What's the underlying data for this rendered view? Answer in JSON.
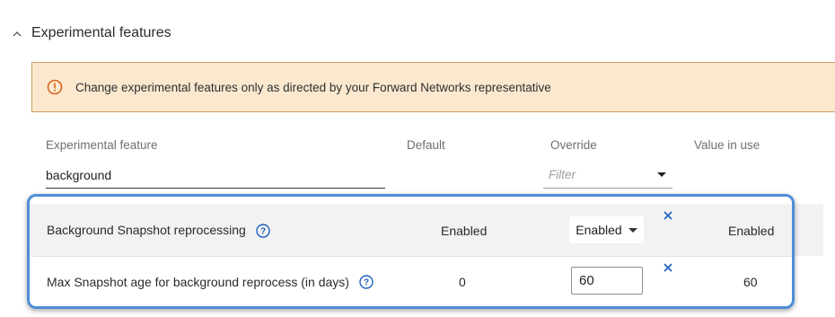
{
  "section": {
    "title": "Experimental features",
    "icon": "chevron-up-icon"
  },
  "banner": {
    "icon": "alert-circle-icon",
    "text": "Change experimental features only as directed by your Forward Networks representative",
    "background": "#fbe8cf",
    "border": "#d4a063"
  },
  "table": {
    "columns": [
      "Experimental feature",
      "Default",
      "Override",
      "Value in use"
    ],
    "feature_filter_value": "background",
    "override_filter_placeholder": "Filter",
    "rows": [
      {
        "feature": "Background Snapshot reprocessing",
        "default": "Enabled",
        "override": "Enabled",
        "value_in_use": "Enabled"
      },
      {
        "feature": "Max Snapshot age for background reprocess (in days)",
        "default": "0",
        "override": "60",
        "value_in_use": "60"
      }
    ]
  },
  "colors": {
    "accent": "#1b5fc1",
    "highlight_border": "#4f8ed8",
    "row_background": "#f2f2f2"
  }
}
